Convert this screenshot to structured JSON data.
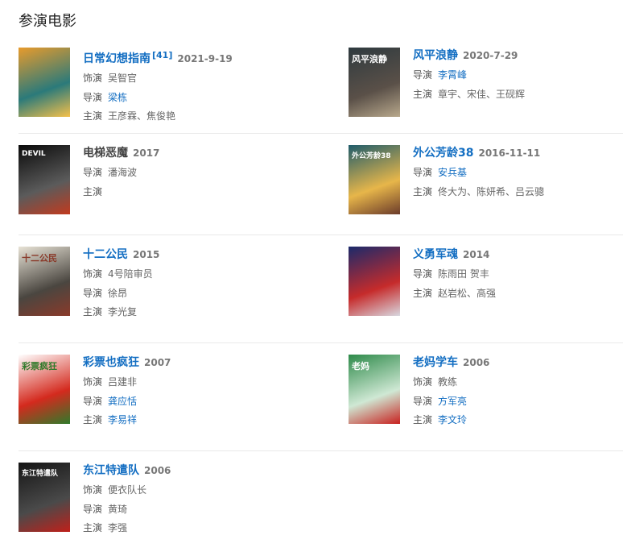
{
  "section_title": "参演电影",
  "labels": {
    "role": "饰演",
    "director": "导演",
    "cast": "主演"
  },
  "movies": [
    {
      "title": "日常幻想指南",
      "ref": "[41]",
      "date": "2021-9-19",
      "role": "吴智官",
      "director": "梁栋",
      "director_link": true,
      "cast": "王彦霖、焦俊艳",
      "poster_colors": [
        "#e89b2c",
        "#2b7a7a",
        "#f5c04a"
      ]
    },
    {
      "title": "风平浪静",
      "date": "2020-7-29",
      "director": "李霄峰",
      "director_link": true,
      "cast": "章宇、宋佳、王砚辉",
      "poster_text": "风平浪静",
      "poster_colors": [
        "#2e3a3f",
        "#5a5048",
        "#b8a88c"
      ]
    },
    {
      "title": "电梯恶魔",
      "date": "2017",
      "director": "潘海波",
      "cast": "",
      "poster_text": "DEVIL",
      "poster_colors": [
        "#0a0a0a",
        "#5b5b5b",
        "#c23a1e"
      ]
    },
    {
      "title": "外公芳龄38",
      "date": "2016-11-11",
      "director": "安兵基",
      "director_link": true,
      "cast": "佟大为、陈妍希、吕云骢",
      "poster_text": "外公芳龄38",
      "poster_colors": [
        "#1f5c6b",
        "#e7b64a",
        "#6b3b2a"
      ]
    },
    {
      "title": "十二公民",
      "date": "2015",
      "role": "4号陪审员",
      "director": "徐昂",
      "cast": "李光复",
      "poster_text": "十二公民",
      "poster_colors": [
        "#e8e3d6",
        "#4a4640",
        "#8a3a2a"
      ]
    },
    {
      "title": "义勇军魂",
      "date": "2014",
      "director": "陈雨田 贺丰",
      "cast": "赵岩松、高强",
      "poster_colors": [
        "#1b2a6b",
        "#c62b2b",
        "#d8d8e0"
      ]
    },
    {
      "title": "彩票也疯狂",
      "date": "2007",
      "role": "吕建非",
      "director": "龚应恬",
      "director_link": true,
      "cast": "李易祥",
      "cast_link": true,
      "poster_text": "彩票疯狂",
      "poster_colors": [
        "#ffffff",
        "#d42a1e",
        "#2f7a2a"
      ]
    },
    {
      "title": "老妈学车",
      "date": "2006",
      "role": "教练",
      "director": "方军亮",
      "director_link": true,
      "cast": "李文玲",
      "cast_link": true,
      "poster_text": "老妈",
      "poster_colors": [
        "#2e8a4a",
        "#cfe8d4",
        "#c8201e"
      ]
    },
    {
      "title": "东江特遣队",
      "date": "2006",
      "role": "便衣队长",
      "director": "黄琦",
      "cast": "李强",
      "poster_text": "东江特遣队",
      "poster_colors": [
        "#151515",
        "#4a4a4a",
        "#c0201a"
      ]
    }
  ]
}
